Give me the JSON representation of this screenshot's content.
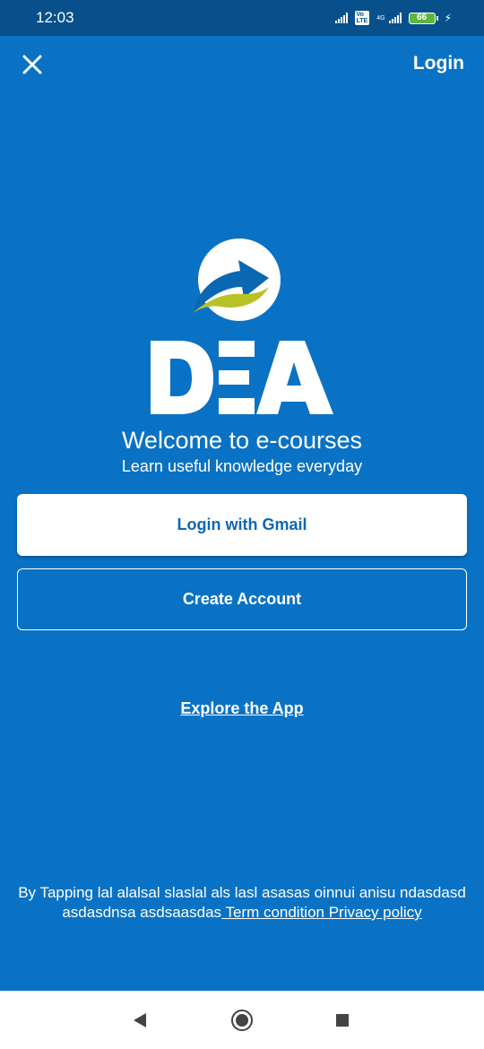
{
  "status_bar": {
    "time": "12:03",
    "network_type": "4G",
    "volte_label": "Vo LTE",
    "battery_level": "66",
    "icons": [
      "signal-icon",
      "volte-icon",
      "signal-4g-icon",
      "battery-icon",
      "charging-icon"
    ]
  },
  "header": {
    "close_icon": "close-icon",
    "login_label": "Login"
  },
  "brand": {
    "logo_text": "DEA",
    "colors": {
      "background": "#0A72C4",
      "accent_green": "#B8C227",
      "brand_blue": "#0A67B2"
    }
  },
  "welcome": {
    "title": "Welcome to e-courses",
    "subtitle": "Learn useful knowledge everyday"
  },
  "actions": {
    "gmail_label": "Login with Gmail",
    "create_label": "Create Account",
    "explore_label": "Explore the App"
  },
  "terms": {
    "prefix": "By Tapping lal alalsal slaslal als lasl asasas oinnui anisu ndasdasd asdasdnsa asdsaasdas",
    "link_label": " Term condition Privacy policy"
  },
  "nav_bar": {
    "icons": [
      "back-icon",
      "home-icon",
      "recents-icon"
    ]
  }
}
